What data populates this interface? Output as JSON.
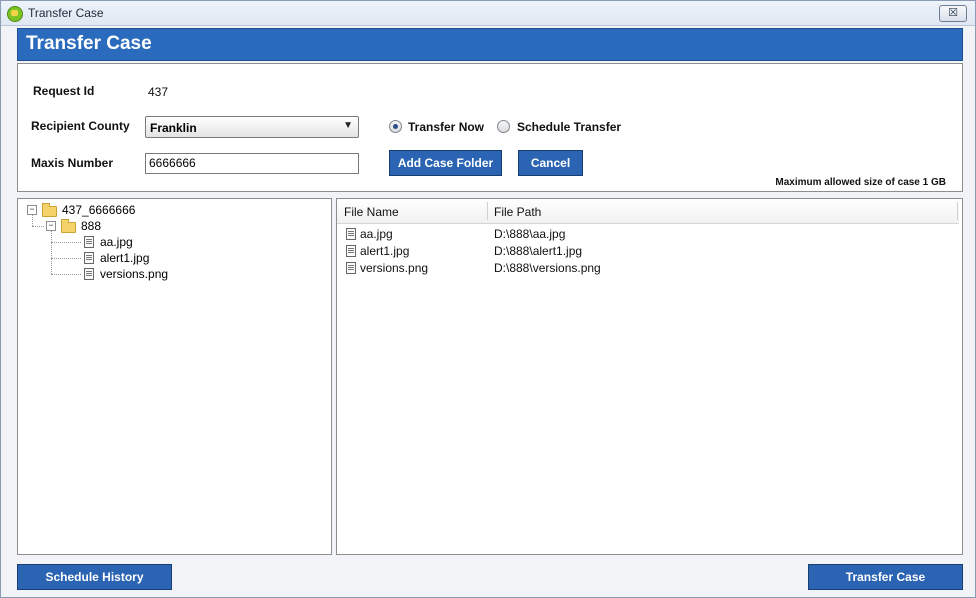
{
  "window": {
    "title": "Transfer Case",
    "close_glyph": "☒"
  },
  "header": {
    "title": "Transfer Case"
  },
  "form": {
    "request_id_label": "Request Id",
    "request_id_value": "437",
    "county_label": "Recipient County",
    "county_value": "Franklin",
    "maxis_label": "Maxis Number",
    "maxis_value": "6666666",
    "transfer_now_label": "Transfer Now",
    "schedule_transfer_label": "Schedule Transfer",
    "selected_option": "Transfer Now",
    "add_case_folder_label": "Add Case Folder",
    "cancel_label": "Cancel",
    "max_size_note": "Maximum allowed size of case 1 GB"
  },
  "tree": {
    "root": "437_6666666",
    "folder": "888",
    "files": [
      "aa.jpg",
      "alert1.jpg",
      "versions.png"
    ]
  },
  "file_list": {
    "columns": [
      "File Name",
      "File Path"
    ],
    "rows": [
      {
        "name": "aa.jpg",
        "path": "D:\\888\\aa.jpg"
      },
      {
        "name": "alert1.jpg",
        "path": "D:\\888\\alert1.jpg"
      },
      {
        "name": "versions.png",
        "path": "D:\\888\\versions.png"
      }
    ]
  },
  "footer": {
    "schedule_history_label": "Schedule History",
    "transfer_case_label": "Transfer Case"
  },
  "colors": {
    "header_blue": "#2a6bbd",
    "button_blue": "#2a64b3"
  },
  "icons": {
    "app": "app-icon",
    "close": "close-icon",
    "folder": "folder-icon",
    "file": "file-icon",
    "dropdown": "chevron-down-icon"
  }
}
